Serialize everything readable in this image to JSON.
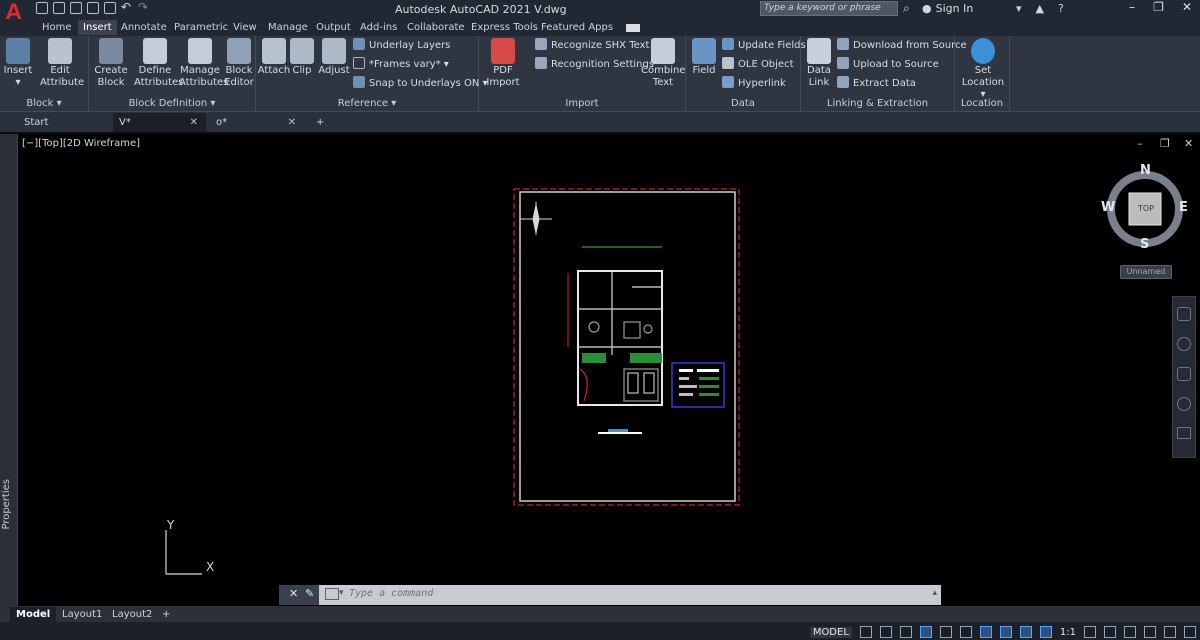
{
  "titlebar": {
    "app_letter": "A",
    "title": "Autodesk AutoCAD 2021   V.dwg",
    "search_placeholder": "Type a keyword or phrase",
    "signin": "Sign In",
    "window_controls": [
      "–",
      "❐",
      "✕"
    ]
  },
  "ribbon_tabs": [
    "Home",
    "Insert",
    "Annotate",
    "Parametric",
    "View",
    "Manage",
    "Output",
    "Add-ins",
    "Collaborate",
    "Express Tools",
    "Featured Apps"
  ],
  "ribbon": {
    "block": {
      "title": "Block ▾",
      "insert": "Insert",
      "edit_attribute_1": "Edit",
      "edit_attribute_2": "Attribute"
    },
    "block_definition": {
      "title": "Block Definition ▾",
      "create_1": "Create",
      "create_2": "Block",
      "define_1": "Define",
      "define_2": "Attributes",
      "manage_1": "Manage",
      "manage_2": "Attributes",
      "editor_1": "Block",
      "editor_2": "Editor"
    },
    "reference": {
      "title": "Reference ▾",
      "attach": "Attach",
      "clip": "Clip",
      "adjust": "Adjust",
      "underlay_layers": "Underlay Layers",
      "frames_vary": "*Frames vary*",
      "snap_underlays": "Snap to Underlays ON"
    },
    "import": {
      "title": "Import",
      "pdf_1": "PDF",
      "pdf_2": "Import",
      "recognize_shx": "Recognize SHX Text",
      "recognition_settings": "Recognition Settings",
      "combine_1": "Combine",
      "combine_2": "Text"
    },
    "data": {
      "title": "Data",
      "field": "Field",
      "update_fields": "Update Fields",
      "ole_object": "OLE Object",
      "hyperlink": "Hyperlink"
    },
    "linking": {
      "title": "Linking & Extraction",
      "data_link_1": "Data",
      "data_link_2": "Link",
      "download": "Download from Source",
      "upload": "Upload to Source",
      "extract": "Extract  Data"
    },
    "location": {
      "title": "Location",
      "set_1": "Set",
      "set_2": "Location"
    }
  },
  "file_tabs": [
    {
      "label": "Start"
    },
    {
      "label": "V*"
    },
    {
      "label": "o*"
    }
  ],
  "viewport": {
    "label": "[−][Top][2D Wireframe]",
    "viewcube": {
      "top": "TOP",
      "n": "N",
      "s": "S",
      "e": "E",
      "w": "W",
      "ucs_menu": "Unnamed"
    },
    "axis_y": "Y",
    "axis_x": "X"
  },
  "side_panel": "Properties",
  "command": {
    "placeholder": "Type a command"
  },
  "layout_tabs": [
    "Model",
    "Layout1",
    "Layout2",
    "+"
  ],
  "status": {
    "model": "MODEL",
    "scale": "1:1"
  },
  "colors": {
    "ribbon": "#2f3541",
    "viewport": "#000000",
    "accent": "#5aa7ff",
    "logo": "#e02b2b"
  }
}
